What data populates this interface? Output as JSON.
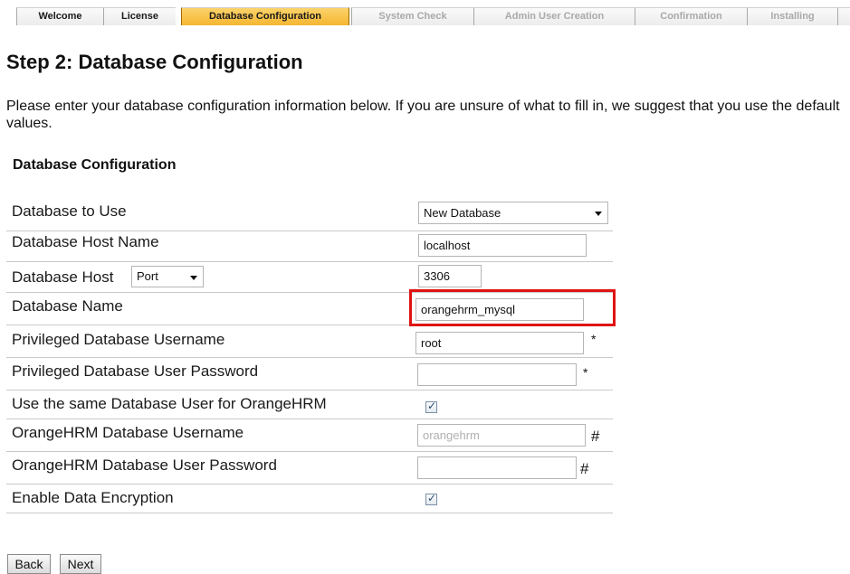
{
  "tabs": [
    {
      "label": "Welcome",
      "state": "normal"
    },
    {
      "label": "License",
      "state": "normal"
    },
    {
      "label": "Database Configuration",
      "state": "active"
    },
    {
      "label": "System Check",
      "state": "disabled"
    },
    {
      "label": "Admin User Creation",
      "state": "disabled"
    },
    {
      "label": "Confirmation",
      "state": "disabled"
    },
    {
      "label": "Installing",
      "state": "disabled"
    }
  ],
  "page": {
    "heading": "Step 2: Database Configuration",
    "intro": "Please enter your database configuration information below. If you are unsure of what to fill in, we suggest that you use the default values.",
    "section_title": "Database Configuration"
  },
  "form": {
    "db_to_use": {
      "label": "Database to Use",
      "value": "New Database"
    },
    "db_host": {
      "label": "Database Host Name",
      "value": "localhost"
    },
    "db_port": {
      "label": "Database Host",
      "option": "Port",
      "value": "3306"
    },
    "db_name": {
      "label": "Database Name",
      "value": "orangehrm_mysql"
    },
    "priv_user": {
      "label": "Privileged Database Username",
      "value": "root",
      "marker": "*"
    },
    "priv_pass": {
      "label": "Privileged Database User Password",
      "value": "",
      "marker": "*"
    },
    "same_user": {
      "label": "Use the same Database User for OrangeHRM",
      "checked": true
    },
    "ohrm_user": {
      "label": "OrangeHRM Database Username",
      "placeholder": "orangehrm",
      "marker": "#"
    },
    "ohrm_pass": {
      "label": "OrangeHRM Database User Password",
      "value": "",
      "marker": "#"
    },
    "encryption": {
      "label": "Enable Data Encryption",
      "checked": true
    }
  },
  "buttons": {
    "back": "Back",
    "next": "Next"
  },
  "colors": {
    "active_tab": "#f5b632",
    "highlight": "#e01313"
  }
}
